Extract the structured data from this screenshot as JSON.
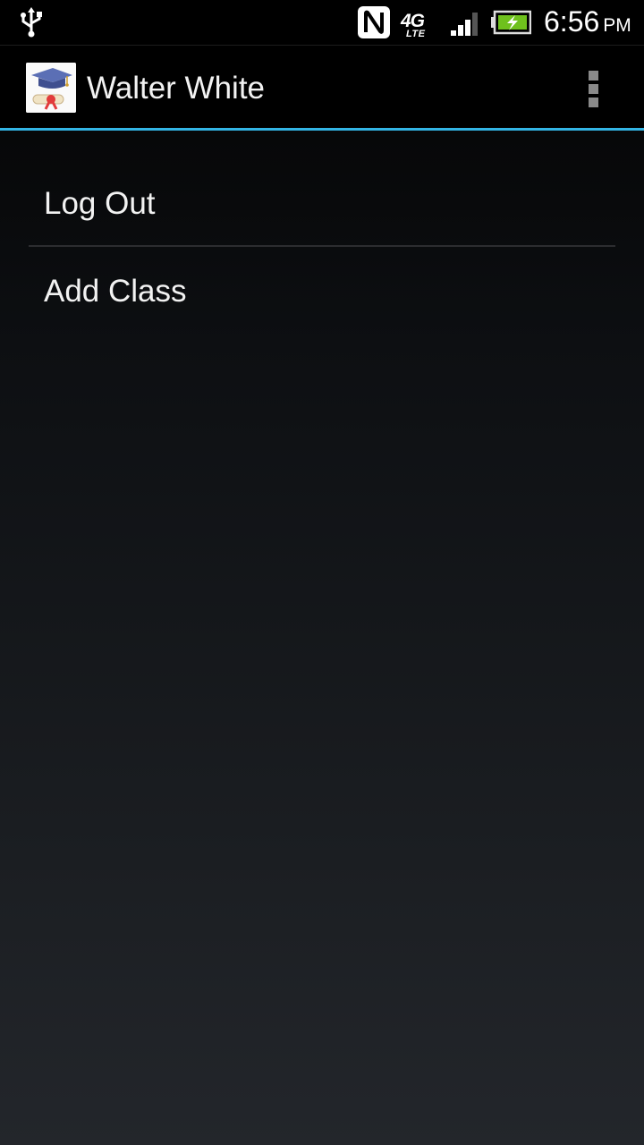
{
  "status_bar": {
    "icons": [
      "usb-icon",
      "nfc-icon",
      "network-4g-lte-icon",
      "signal-icon",
      "battery-charging-icon"
    ],
    "network_type": "4G",
    "network_subtype": "LTE",
    "time": "6:56",
    "ampm": "PM",
    "battery_color": "#6fc11d"
  },
  "action_bar": {
    "title": "Walter White",
    "accent_color": "#33b5e5",
    "icon": "graduation-cap-diploma-icon"
  },
  "menu": {
    "items": [
      {
        "label": "Log Out"
      },
      {
        "label": "Add Class"
      }
    ]
  }
}
